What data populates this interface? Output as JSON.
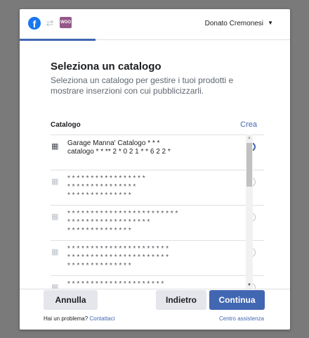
{
  "header": {
    "fb_logo": "f",
    "sync_icon": "⇄",
    "woo_logo": "WOO",
    "user_name": "Donato Cremonesi",
    "caret": "▼",
    "progress_fraction": 0.28
  },
  "main": {
    "title": "Seleziona un catalogo",
    "subtitle": "Seleziona un catalogo per gestire i tuoi prodotti e mostrare inserzioni con cui pubblicizzarli.",
    "section_label": "Catalogo",
    "create_link": "Crea"
  },
  "catalogs": [
    {
      "l1": "Garage Manna' Catalogo * * *",
      "l2": "catalogo * * ** 2 * 0 2 1 * * 6 2 2 *",
      "l3": "",
      "selected": true,
      "faded": false
    },
    {
      "l1": "* * * * * * * * * * * * * * * * *",
      "l2": "* * * * * * * * * * * * * * *",
      "l3": "* * * * * * * * * * * * * *",
      "selected": false,
      "faded": true
    },
    {
      "l1": "* * * * * * * * * * * * * * * * * * * * * * * *",
      "l2": "* * * * * * * * * * * * * * * * * *",
      "l3": "* * * * * * * * * * * * * *",
      "selected": false,
      "faded": true
    },
    {
      "l1": "* * * * * * * * * * * * * * * * * * * * * *",
      "l2": "* * * * * * * * * * * * * * * * * * * * * *",
      "l3": "* * * * * * * * * * * * * *",
      "selected": false,
      "faded": true
    },
    {
      "l1": "* * * * * * * * * * * * * * * * * * * * *",
      "l2": "* * * * * * * * * * * * * * * * * *",
      "l3": "",
      "selected": false,
      "faded": true
    }
  ],
  "catalog_icon": "▦",
  "scrollbar": {
    "up": "▲",
    "down": "▼"
  },
  "footer": {
    "cancel_label": "Annulla",
    "back_label": "Indietro",
    "continue_label": "Continua",
    "help_text": "Hai un problema? ",
    "help_link": "Contattaci",
    "center_link": "Centro assistenza"
  },
  "colors": {
    "accent": "#4267b2",
    "woo": "#96588a",
    "facebook": "#1877f2"
  }
}
